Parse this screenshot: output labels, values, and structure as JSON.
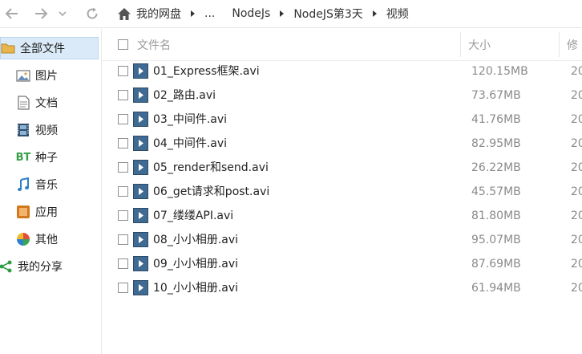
{
  "toolbar": {
    "back_icon": "arrow-left-icon",
    "forward_icon": "arrow-right-icon",
    "history_icon": "chevron-down-icon",
    "refresh_icon": "refresh-icon",
    "home_icon": "home-icon"
  },
  "breadcrumb": [
    "我的网盘",
    "...",
    "NodeJs",
    "NodeJS第3天",
    "视频"
  ],
  "sidebar": {
    "items": [
      {
        "label": "全部文件",
        "icon": "folder-icon",
        "active": true
      },
      {
        "label": "图片",
        "icon": "image-icon"
      },
      {
        "label": "文档",
        "icon": "document-icon"
      },
      {
        "label": "视频",
        "icon": "film-icon"
      },
      {
        "label": "种子",
        "icon": "bt-icon",
        "icon_text": "BT"
      },
      {
        "label": "音乐",
        "icon": "music-icon"
      },
      {
        "label": "应用",
        "icon": "app-icon"
      },
      {
        "label": "其他",
        "icon": "other-icon"
      },
      {
        "label": "我的分享",
        "icon": "share-icon"
      }
    ]
  },
  "columns": {
    "name": "文件名",
    "size": "大小",
    "modified": "修"
  },
  "files": [
    {
      "name": "01_Express框架.avi",
      "size": "120.15MB",
      "date": "20"
    },
    {
      "name": "02_路由.avi",
      "size": "73.67MB",
      "date": "20"
    },
    {
      "name": "03_中间件.avi",
      "size": "41.76MB",
      "date": "20"
    },
    {
      "name": "04_中间件.avi",
      "size": "82.95MB",
      "date": "20"
    },
    {
      "name": "05_render和send.avi",
      "size": "26.22MB",
      "date": "20"
    },
    {
      "name": "06_get请求和post.avi",
      "size": "45.57MB",
      "date": "20"
    },
    {
      "name": "07_缕缕API.avi",
      "size": "81.80MB",
      "date": "20"
    },
    {
      "name": "08_小小相册.avi",
      "size": "95.07MB",
      "date": "20"
    },
    {
      "name": "09_小小相册.avi",
      "size": "87.69MB",
      "date": "20"
    },
    {
      "name": "10_小小相册.avi",
      "size": "61.94MB",
      "date": "20"
    }
  ],
  "colors": {
    "accent": "#dbeaf8",
    "video_icon": "#3f6a92"
  }
}
